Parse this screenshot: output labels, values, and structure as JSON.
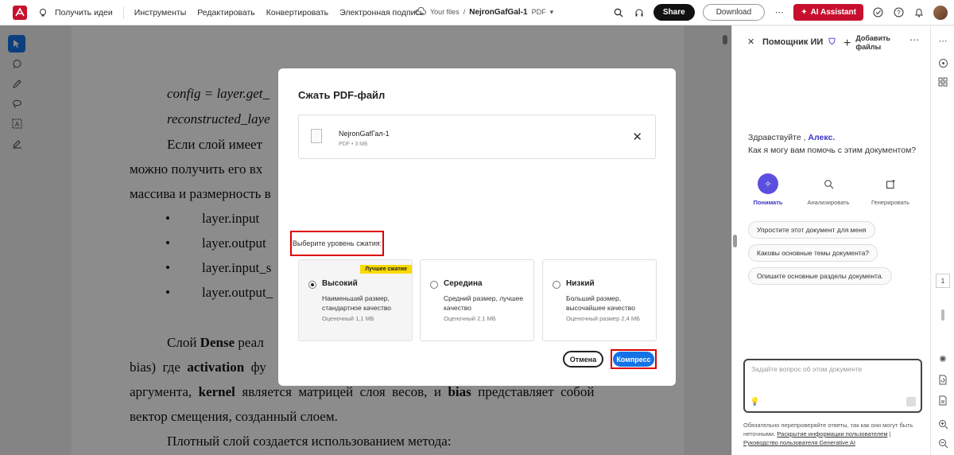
{
  "topbar": {
    "get_ideas": "Получить идеи",
    "menu": [
      "Инструменты",
      "Редактировать",
      "Конвертировать",
      "Электронная подпись"
    ],
    "your_files": "Your files",
    "slash": "/",
    "file_name": "NejronGafGal-1",
    "file_type": "PDF",
    "share": "Share",
    "download": "Download",
    "ai_assistant": "AI Assistant",
    "accent_red": "#c8102e",
    "icons": [
      "adobe-acrobat-logo",
      "lightbulb-icon",
      "search-icon",
      "headphones-icon",
      "more-icon",
      "check-circle-icon",
      "help-icon",
      "bell-icon"
    ]
  },
  "left_tools": [
    "select-arrow-icon",
    "comment-icon",
    "pen-icon",
    "lasso-icon",
    "text-select-icon",
    "sign-icon"
  ],
  "document": {
    "lines": [
      {
        "text": "config = layer.get_",
        "italic": true
      },
      {
        "text": "reconstructed_laye",
        "italic": true
      },
      {
        "text": "Если слой имеет",
        "italic": false
      },
      {
        "text": "можно получить его вх",
        "italic": false
      },
      {
        "text": "массива и размерность в",
        "italic": false
      },
      {
        "text": "layer.input",
        "bullet": true
      },
      {
        "text": "layer.output",
        "bullet": true
      },
      {
        "text": "layer.input_s",
        "bullet": true
      },
      {
        "text": "layer.output_",
        "bullet": true
      }
    ],
    "para2": {
      "l1_a": "Слой ",
      "l1_b": "Dense",
      "l1_c": " реал",
      "l2_a": "bias)  где  ",
      "l2_b": "activation",
      "l2_c": "  фу",
      "l3_a": "аргумента,  ",
      "l3_b": "kernel",
      "l3_c": "  является  матрицей  слоя  весов,  и  ",
      "l3_d": "bias",
      "l3_e": "  представляет  собой",
      "l4": "вектор смещения, созданный слоем.",
      "l5": "Плотный слой создается использованием метода:"
    }
  },
  "dialog": {
    "title": "Сжать PDF-файл",
    "file": {
      "name": "NejronGafГал-1",
      "meta": "PDF • 3 МБ"
    },
    "level_label": "Выберите уровень сжатия:",
    "options": [
      {
        "title": "Высокий",
        "desc": "Наименьший размер, стандартное качество",
        "est": "Оценочный 1,1 МБ",
        "badge": "Лучшее сжатие",
        "selected": true
      },
      {
        "title": "Середина",
        "desc": "Средний размер, лучшее качество",
        "est": "Оценочный 2,1 МБ",
        "badge": "",
        "selected": false
      },
      {
        "title": "Низкий",
        "desc": "Больший размер, высочайшее качество",
        "est": "Оценочный размер 2,4 МБ",
        "badge": "",
        "selected": false
      }
    ],
    "cancel": "Отмена",
    "compress": "Компресс",
    "compress_color": "#1473e6"
  },
  "right_panel": {
    "title": "Помощник ИИ",
    "add_files_l1": "Добавить",
    "add_files_l2": "файлы",
    "greeting_hello": "Здравствуйте ,",
    "greeting_name": "Алекс.",
    "greeting_question": "Как я могу вам помочь с этим документом?",
    "modes": [
      "Понимать",
      "Анализировать",
      "Генерировать"
    ],
    "suggestions": [
      "Упростите этот документ для меня",
      "Каковы основные темы документа?",
      "Опишите основные разделы документа."
    ],
    "input_placeholder": "Задайте вопрос об этом документе",
    "footer_text": "Обязательно перепроверяйте ответы, так как они могут быть неточными.",
    "footer_link1": "Раскрытие информации пользователем",
    "footer_sep": " | ",
    "footer_link2": "Руководство пользователя Generative AI",
    "name_color": "#3a35c4"
  },
  "right_rail": {
    "page_number": "1"
  }
}
